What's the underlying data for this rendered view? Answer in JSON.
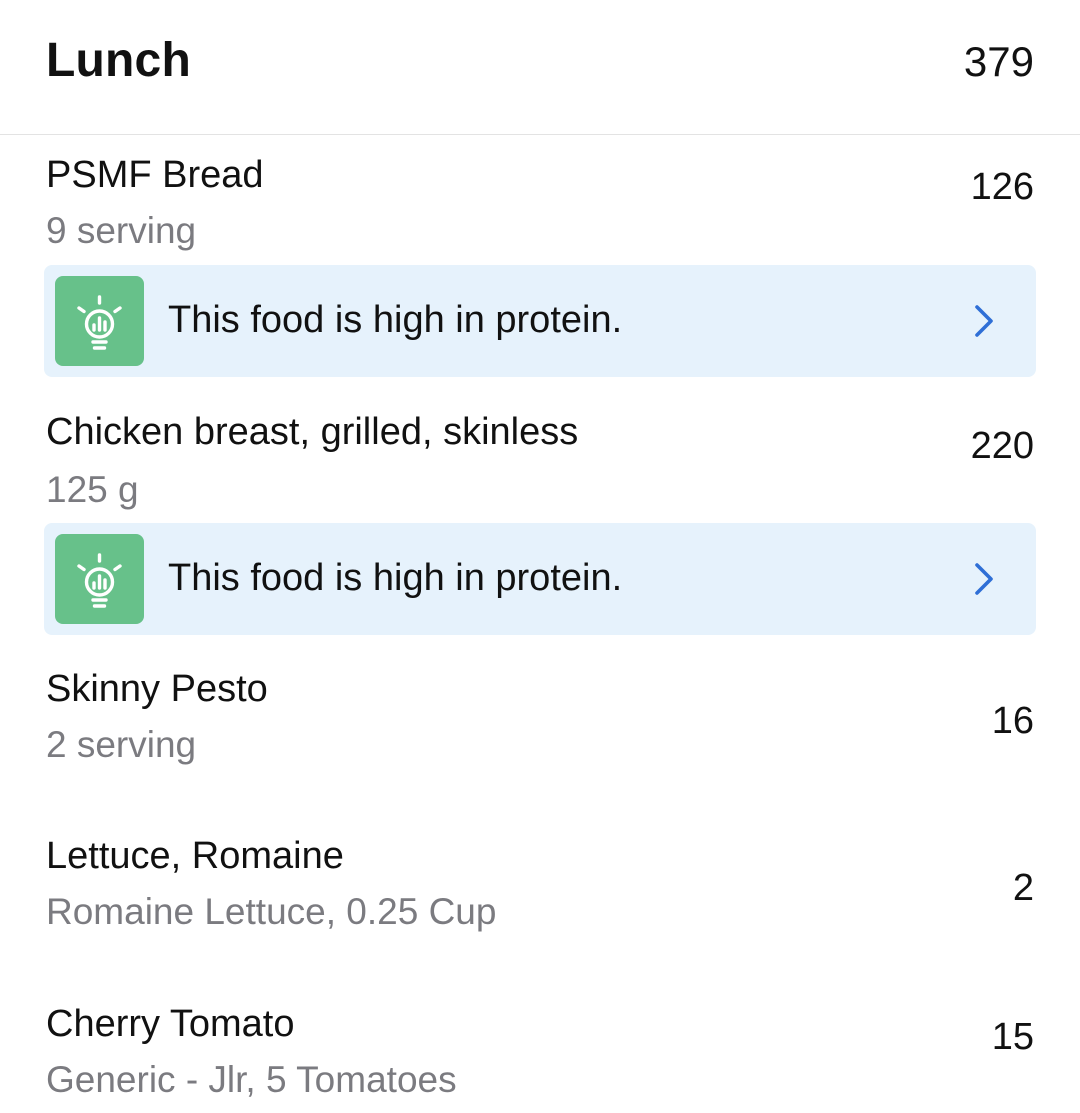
{
  "meal": {
    "title": "Lunch",
    "total_calories": "379"
  },
  "items": [
    {
      "name": "PSMF Bread",
      "detail": "9 serving",
      "calories": "126",
      "insight": {
        "text": "This food is high in protein.",
        "icon": "lightbulb-icon"
      }
    },
    {
      "name": "Chicken breast, grilled, skinless",
      "detail": "125 g",
      "calories": "220",
      "insight": {
        "text": "This food is high in protein.",
        "icon": "lightbulb-icon"
      }
    },
    {
      "name": "Skinny Pesto",
      "detail": "2 serving",
      "calories": "16"
    },
    {
      "name": "Lettuce, Romaine",
      "detail": "Romaine Lettuce, 0.25 Cup",
      "calories": "2"
    },
    {
      "name": "Cherry Tomato",
      "detail": "Generic - Jlr, 5 Tomatoes",
      "calories": "15"
    }
  ],
  "colors": {
    "insight_background": "#e6f2fc",
    "insight_icon_background": "#67c18a",
    "chevron": "#2f6fd6",
    "secondary_text": "#7b7b80"
  }
}
